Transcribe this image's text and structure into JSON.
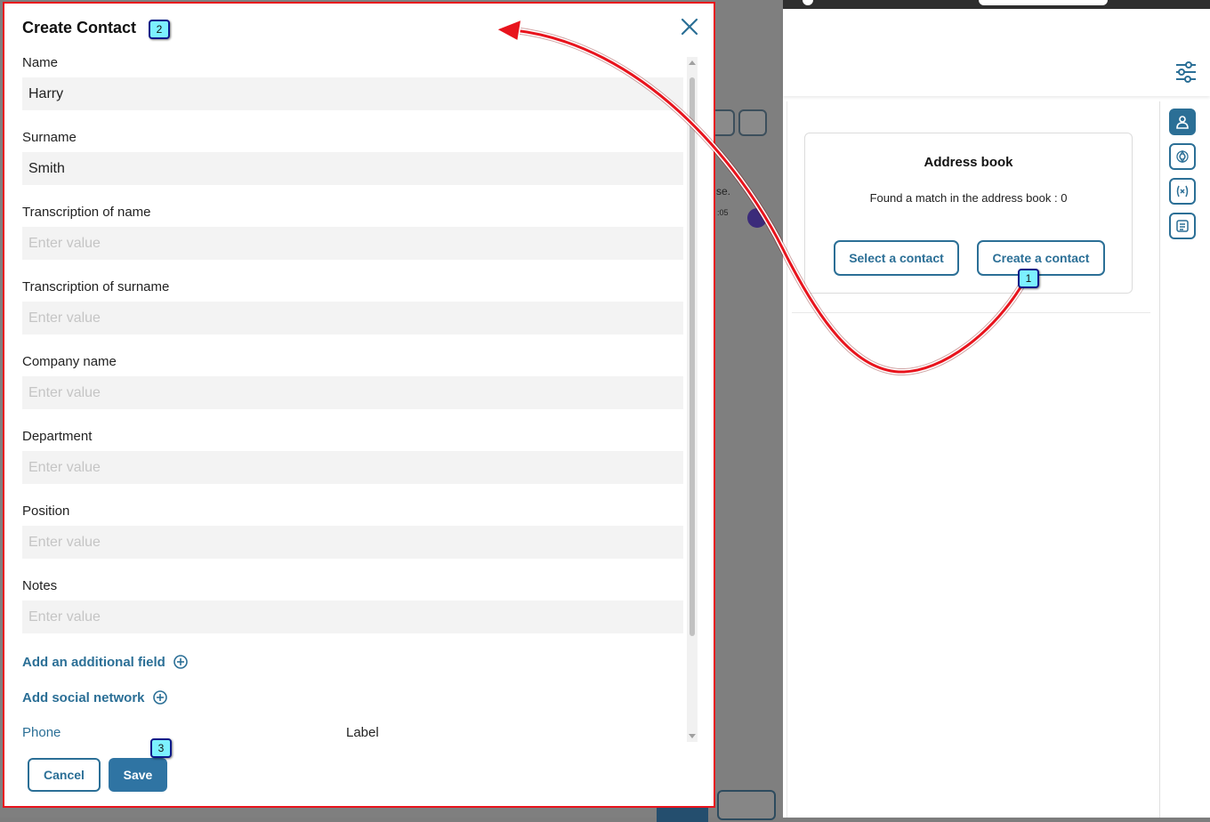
{
  "modal": {
    "title": "Create Contact",
    "fields": [
      {
        "label": "Name",
        "value": "Harry",
        "placeholder": "Enter value"
      },
      {
        "label": "Surname",
        "value": "Smith",
        "placeholder": "Enter value"
      },
      {
        "label": "Transcription of name",
        "value": "",
        "placeholder": "Enter value"
      },
      {
        "label": "Transcription of surname",
        "value": "",
        "placeholder": "Enter value"
      },
      {
        "label": "Company name",
        "value": "",
        "placeholder": "Enter value"
      },
      {
        "label": "Department",
        "value": "",
        "placeholder": "Enter value"
      },
      {
        "label": "Position",
        "value": "",
        "placeholder": "Enter value"
      },
      {
        "label": "Notes",
        "value": "",
        "placeholder": "Enter value"
      }
    ],
    "add_field_label": "Add an additional field",
    "add_social_label": "Add social network",
    "phone_label": "Phone",
    "label_col": "Label",
    "cancel_label": "Cancel",
    "save_label": "Save"
  },
  "address_book": {
    "title": "Address book",
    "subtitle": "Found a match in the address book : 0",
    "select_label": "Select a contact",
    "create_label": "Create a contact"
  },
  "annotations": [
    "1",
    "2",
    "3"
  ],
  "background_fragments": {
    "text1": "se.",
    "text2": ":05"
  },
  "colors": {
    "accent": "#2b6f96",
    "modal_border": "#e8141d",
    "badge": "#7cf1ff",
    "arrow": "#e8141d"
  }
}
